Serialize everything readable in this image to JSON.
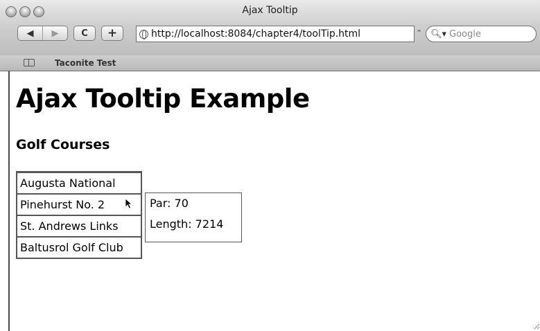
{
  "window": {
    "title": "Ajax Tooltip"
  },
  "toolbar": {
    "back_icon": "◀",
    "forward_icon": "▶",
    "reload_label": "C",
    "add_bookmark_label": "+",
    "url": "http://localhost:8084/chapter4/toolTip.html",
    "search_placeholder": "Google"
  },
  "bookmarks_bar": {
    "items": [
      "Taconite Test"
    ]
  },
  "page": {
    "heading": "Ajax Tooltip Example",
    "subheading": "Golf Courses",
    "courses": [
      "Augusta National",
      "Pinehurst No. 2",
      "St. Andrews Links",
      "Baltusrol Golf Club"
    ],
    "tooltip": {
      "par": "Par: 70",
      "length": "Length: 7214"
    }
  }
}
